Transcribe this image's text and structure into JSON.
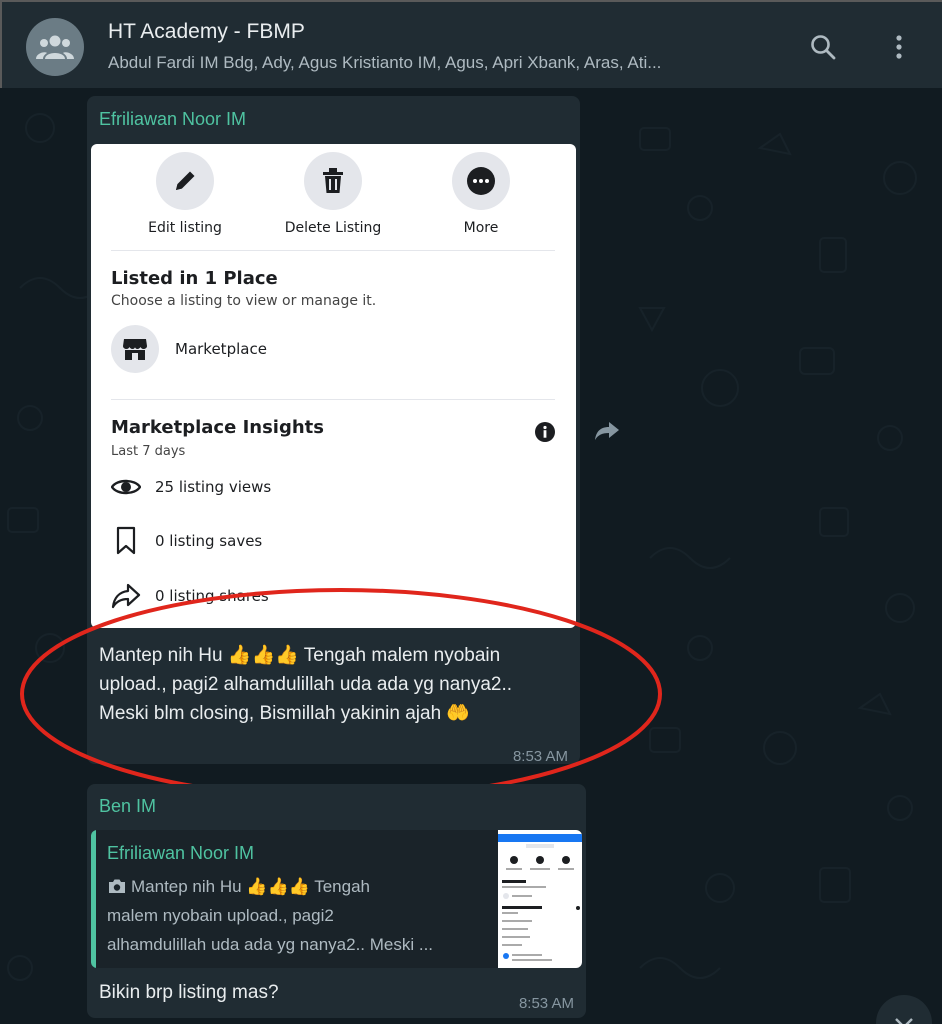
{
  "header": {
    "title": "HT Academy - FBMP",
    "participants": "Abdul Fardi IM Bdg, Ady, Agus Kristianto IM, Agus, Apri Xbank, Aras, Ati...",
    "icons": {
      "avatar": "group-icon",
      "search": "search-icon",
      "menu": "kebab-menu-icon"
    }
  },
  "messages": [
    {
      "sender": "Efriliawan Noor IM",
      "image": {
        "actions": [
          {
            "label": "Edit listing",
            "icon": "pencil-icon"
          },
          {
            "label": "Delete Listing",
            "icon": "trash-icon"
          },
          {
            "label": "More",
            "icon": "more-icon"
          }
        ],
        "listed_title": "Listed in 1 Place",
        "listed_sub": "Choose a listing to view or manage it.",
        "marketplace_label": "Marketplace",
        "insights_title": "Marketplace Insights",
        "insights_period": "Last 7 days",
        "stats": [
          {
            "text": "25 listing views",
            "icon": "eye-icon"
          },
          {
            "text": "0 listing saves",
            "icon": "bookmark-icon"
          },
          {
            "text": "0 listing shares",
            "icon": "share-icon"
          }
        ]
      },
      "text_line1": "Mantep nih Hu 👍👍👍 Tengah malem nyobain",
      "text_line2": "upload., pagi2 alhamdulillah uda ada yg nanya2..",
      "text_line3": "Meski blm closing, Bismillah yakinin ajah 🤲",
      "time": "8:53 AM"
    },
    {
      "sender": "Ben IM",
      "quote": {
        "author": "Efriliawan Noor IM",
        "line1": "Mantep nih Hu 👍👍👍 Tengah",
        "line2": "malem nyobain upload., pagi2",
        "line3": "alhamdulillah uda ada yg nanya2.. Meski ..."
      },
      "text": "Bikin brp listing mas?",
      "time": "8:53 AM"
    }
  ],
  "colors": {
    "header_bg": "#202c33",
    "bubble_bg": "#202c33",
    "sender_green": "#4fc3a1",
    "annotation_red": "#e0261c"
  }
}
